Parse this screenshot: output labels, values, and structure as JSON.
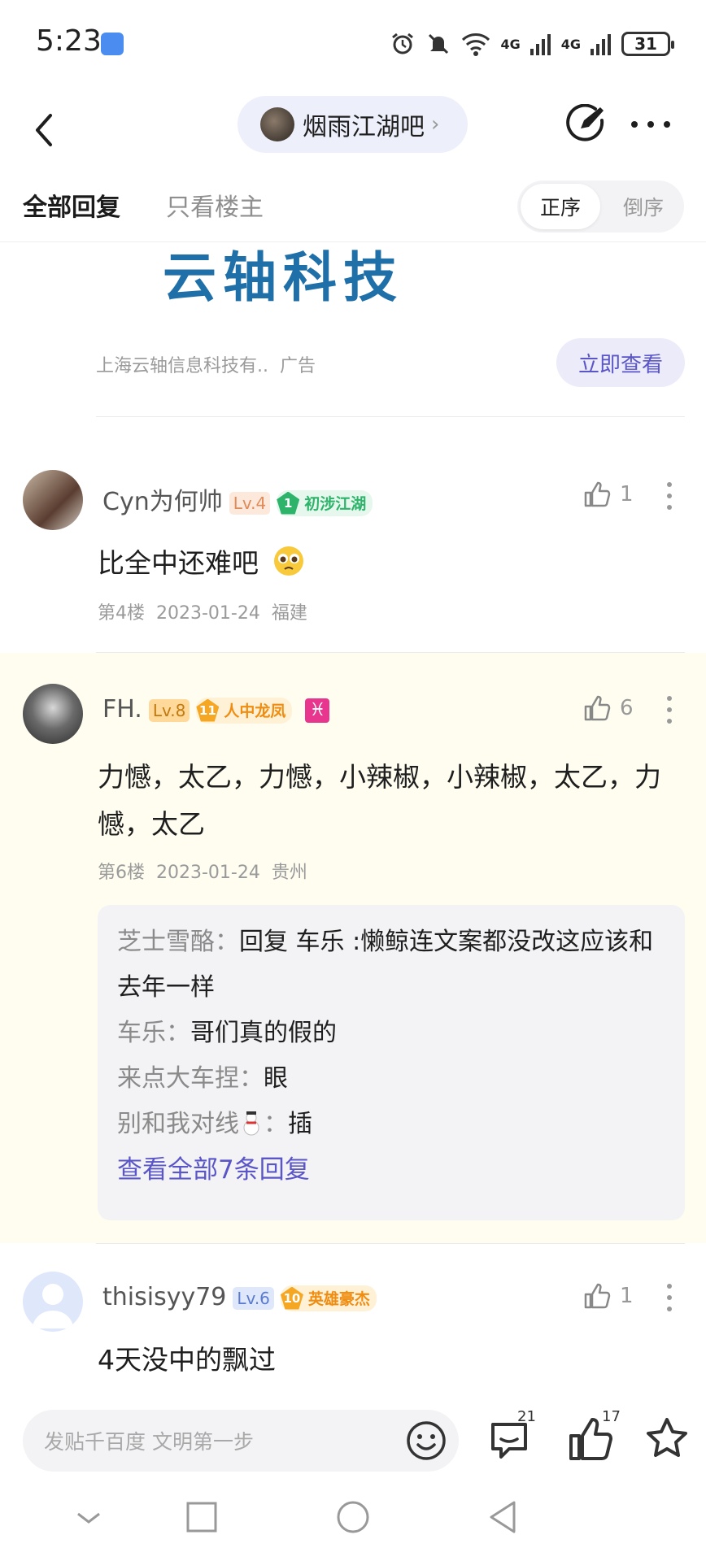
{
  "status": {
    "time": "5:23",
    "battery": "31",
    "net1": "4G",
    "net2": "4G"
  },
  "header": {
    "forum_name": "烟雨江湖吧"
  },
  "tabs": {
    "all": "全部回复",
    "owner_only": "只看楼主",
    "order_asc": "正序",
    "order_desc": "倒序"
  },
  "ad": {
    "logo_text": "云轴科技",
    "advertiser": "上海云轴信息科技有..",
    "ad_label": "广告",
    "cta": "立即查看"
  },
  "posts": [
    {
      "username": "Cyn为何帅",
      "level": "Lv.4",
      "badge_num": "1",
      "badge_title": "初涉江湖",
      "likes": "1",
      "content": "比全中还难吧",
      "floor": "第4楼",
      "date": "2023-01-24",
      "location": "福建"
    },
    {
      "username": "FH.",
      "level": "Lv.8",
      "badge_num": "11",
      "badge_title": "人中龙凤",
      "zodiac": "♓",
      "likes": "6",
      "content": "力憾，太乙，力憾，小辣椒，小辣椒，太乙，力憾，太乙",
      "floor": "第6楼",
      "date": "2023-01-24",
      "location": "贵州",
      "replies": [
        {
          "name": "芝士雪酪",
          "text": "回复 车乐 :懒鲸连文案都没改这应该和去年一样"
        },
        {
          "name": "车乐",
          "text": "哥们真的假的"
        },
        {
          "name": "来点大车捏",
          "text": "眼"
        },
        {
          "name": "别和我对线",
          "text": "插"
        }
      ],
      "view_all": "查看全部7条回复"
    },
    {
      "username": "thisisyy79",
      "level": "Lv.6",
      "badge_num": "10",
      "badge_title": "英雄豪杰",
      "likes": "1",
      "content": "4天没中的飘过"
    }
  ],
  "bottom": {
    "placeholder": "发贴千百度 文明第一步",
    "comment_count": "21",
    "like_count": "17"
  },
  "colors": {
    "accent": "#5a56c8",
    "highlight_bg": "#fffdf0",
    "ad_logo": "#1f6fa8"
  }
}
